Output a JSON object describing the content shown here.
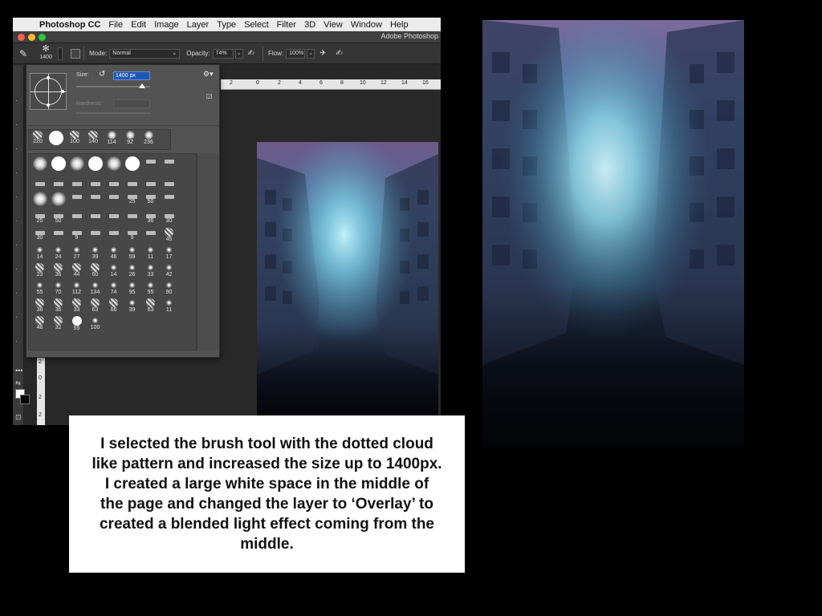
{
  "menubar": {
    "items": [
      "Photoshop CC",
      "File",
      "Edit",
      "Image",
      "Layer",
      "Type",
      "Select",
      "Filter",
      "3D",
      "View",
      "Window",
      "Help"
    ]
  },
  "window": {
    "title": "Adobe Photoshop"
  },
  "options_bar": {
    "brush_size_label": "1400",
    "mode_label": "Mode:",
    "mode_value": "Normal",
    "opacity_label": "Opacity:",
    "opacity_value": "74%",
    "flow_label": "Flow:",
    "flow_value": "100%"
  },
  "brush_panel": {
    "size_label": "Size:",
    "size_value": "1400 px",
    "hardness_label": "Hardness:",
    "recent_brushes": [
      "220",
      "",
      "100",
      "140",
      "114",
      "92",
      "236"
    ],
    "preset_rows": [
      [
        "",
        "",
        "",
        "",
        "",
        "",
        "",
        ""
      ],
      [
        "",
        "",
        "",
        "",
        "",
        "",
        "",
        ""
      ],
      [
        "",
        "",
        "",
        "",
        "",
        "25",
        "50",
        ""
      ],
      [
        "25",
        "50",
        "",
        "",
        "",
        "",
        "36",
        "30"
      ],
      [
        "30",
        "",
        "9",
        "",
        "",
        "9",
        "",
        "45"
      ],
      [
        "14",
        "24",
        "27",
        "39",
        "46",
        "59",
        "11",
        "17"
      ],
      [
        "23",
        "36",
        "44",
        "60",
        "14",
        "26",
        "33",
        "42"
      ],
      [
        "55",
        "70",
        "112",
        "134",
        "74",
        "95",
        "95",
        "90"
      ],
      [
        "36",
        "36",
        "33",
        "63",
        "66",
        "39",
        "63",
        "11"
      ],
      [
        "48",
        "32",
        "55",
        "100",
        "",
        "",
        "",
        ""
      ]
    ]
  },
  "ruler": {
    "h_labels": [
      "2",
      "0",
      "2",
      "4",
      "6",
      "8",
      "10",
      "12",
      "14",
      "16"
    ],
    "v_labels": [
      "2",
      "0",
      "2",
      "2"
    ]
  },
  "caption": {
    "text": "I selected the brush tool with the dotted cloud like pattern and increased the size up to 1400px. I created a large white space in the middle of the page and changed the layer to ‘Overlay’ to created a blended light effect coming from the middle."
  },
  "colors": {
    "foreground": "#ffffff",
    "background": "#000000",
    "selection": "#1f57b5"
  }
}
